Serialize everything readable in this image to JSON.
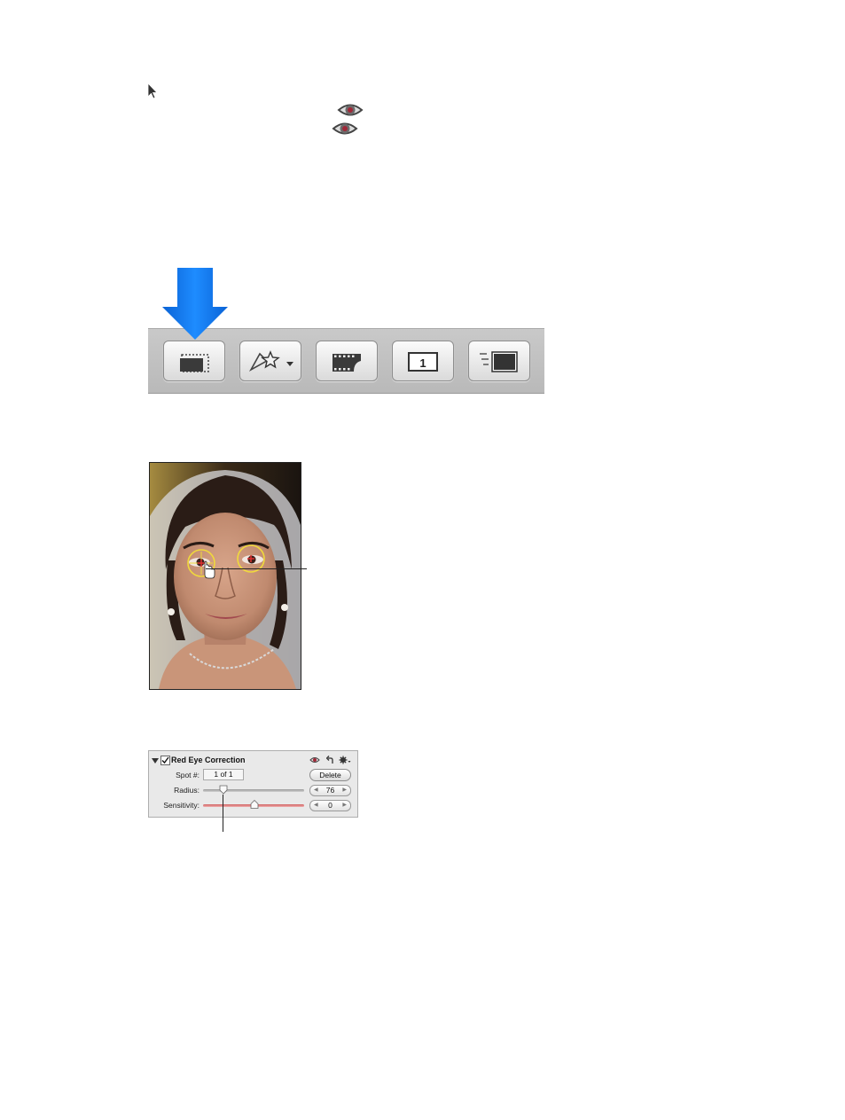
{
  "toolbar": {
    "buttons": [
      {
        "icon": "crop-frame-icon"
      },
      {
        "icon": "rating-keyword-icon"
      },
      {
        "icon": "filmstrip-icon"
      },
      {
        "icon": "single-view-icon",
        "label": "1"
      },
      {
        "icon": "fullscreen-list-icon"
      }
    ],
    "highlight_color": "#1e7ff0"
  },
  "panel": {
    "title": "Red Eye Correction",
    "enabled": true,
    "spot_label": "Spot #:",
    "spot_value": "1 of 1",
    "delete_label": "Delete",
    "radius_label": "Radius:",
    "radius_value": "76",
    "sensitivity_label": "Sensitivity:",
    "sensitivity_value": "0"
  }
}
